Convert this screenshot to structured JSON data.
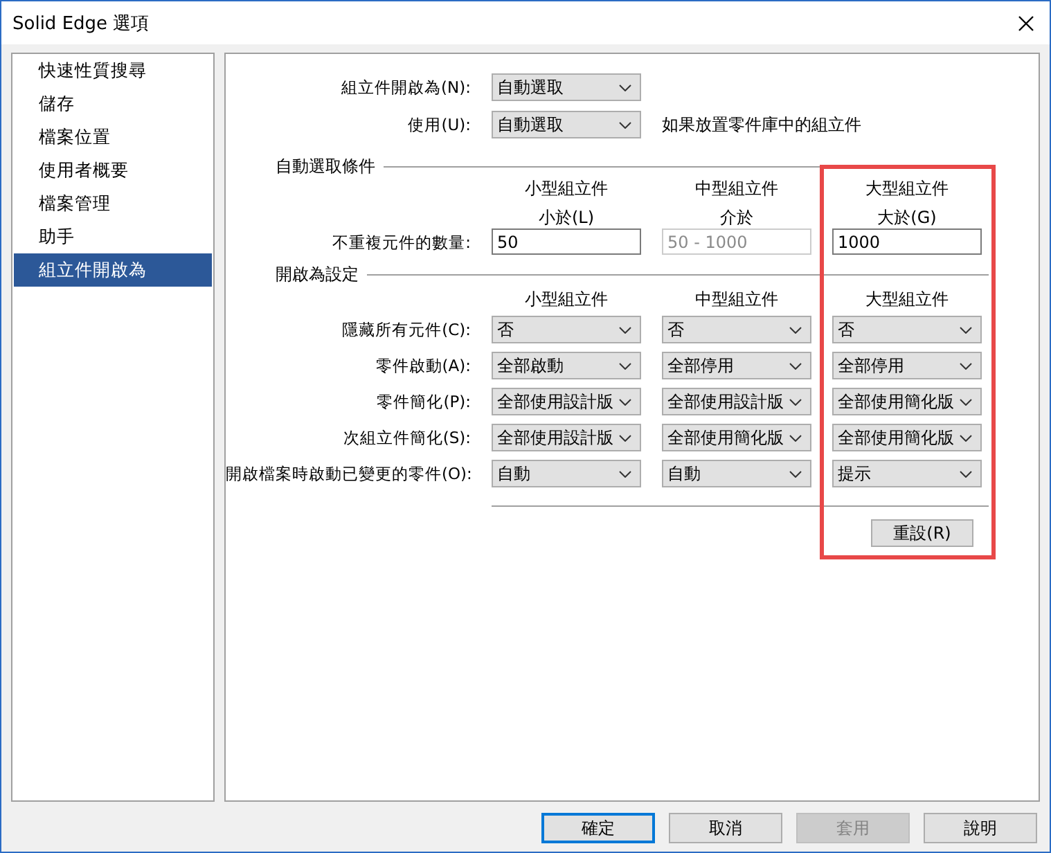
{
  "window": {
    "title": "Solid Edge 選項"
  },
  "sidebar": {
    "items": [
      {
        "label": "快速性質搜尋",
        "selected": false
      },
      {
        "label": "儲存",
        "selected": false
      },
      {
        "label": "檔案位置",
        "selected": false
      },
      {
        "label": "使用者概要",
        "selected": false
      },
      {
        "label": "檔案管理",
        "selected": false
      },
      {
        "label": "助手",
        "selected": false
      },
      {
        "label": "組立件開啟為",
        "selected": true
      }
    ]
  },
  "open_as": {
    "label": "組立件開啟為(N):",
    "value": "自動選取"
  },
  "use": {
    "label": "使用(U):",
    "value": "自動選取",
    "note": "如果放置零件庫中的組立件"
  },
  "auto_select": {
    "title": "自動選取條件",
    "row_label": "不重複元件的數量:",
    "columns": [
      {
        "heading": "小型組立件",
        "sublabel": "小於(L)",
        "value": "50",
        "disabled": false
      },
      {
        "heading": "中型組立件",
        "sublabel": "介於",
        "value": "50 - 1000",
        "disabled": true
      },
      {
        "heading": "大型組立件",
        "sublabel": "大於(G)",
        "value": "1000",
        "disabled": false
      }
    ]
  },
  "highlight_frame": true,
  "open_settings": {
    "title": "開啟為設定",
    "columns": [
      "小型組立件",
      "中型組立件",
      "大型組立件"
    ],
    "rows": [
      {
        "label": "隱藏所有元件(C):",
        "values": [
          "否",
          "否",
          "否"
        ]
      },
      {
        "label": "零件啟動(A):",
        "values": [
          "全部啟動",
          "全部停用",
          "全部停用"
        ]
      },
      {
        "label": "零件簡化(P):",
        "values": [
          "全部使用設計版",
          "全部使用設計版",
          "全部使用簡化版"
        ]
      },
      {
        "label": "次組立件簡化(S):",
        "values": [
          "全部使用設計版",
          "全部使用簡化版",
          "全部使用簡化版"
        ]
      },
      {
        "label": "開啟檔案時啟動已變更的零件(O):",
        "values": [
          "自動",
          "自動",
          "提示"
        ]
      }
    ]
  },
  "reset_button": "重設(R)",
  "buttons": [
    {
      "label": "確定",
      "default": true,
      "disabled": false
    },
    {
      "label": "取消",
      "default": false,
      "disabled": false
    },
    {
      "label": "套用",
      "default": false,
      "disabled": true
    },
    {
      "label": "說明",
      "default": false,
      "disabled": false
    }
  ]
}
